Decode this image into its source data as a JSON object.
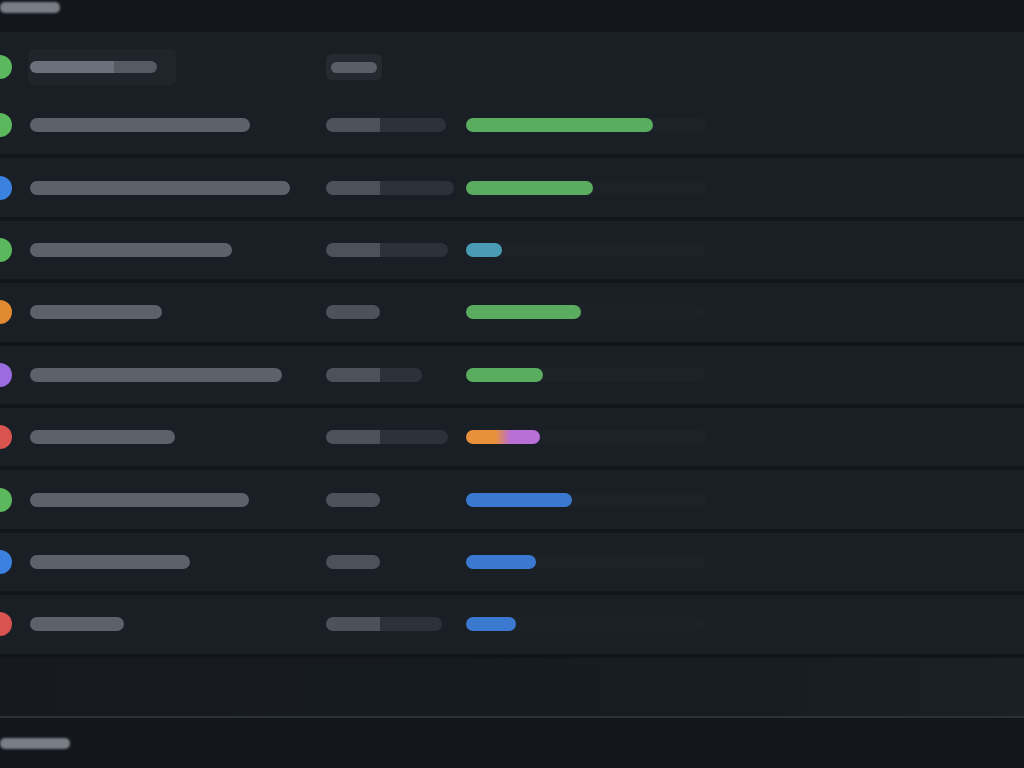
{
  "header": {
    "status": {
      "color": "#5cb85c"
    }
  },
  "rows": [
    {
      "status": {
        "color": "#5cb85c"
      },
      "progress": {
        "color": "#5aad5e",
        "level": 0.78
      }
    },
    {
      "status": {
        "color": "#3b82e0"
      },
      "progress": {
        "color": "#5aad5e",
        "level": 0.53
      }
    },
    {
      "status": {
        "color": "#5cb85c"
      },
      "progress": {
        "color": "#4a9cb5",
        "level": 0.15
      }
    },
    {
      "status": {
        "color": "#e08a30"
      },
      "progress": {
        "color": "#5aad5e",
        "level": 0.48
      }
    },
    {
      "status": {
        "color": "#9b6be0"
      },
      "progress": {
        "color": "#5aad5e",
        "level": 0.32
      }
    },
    {
      "status": {
        "color": "#d9534f"
      },
      "progress": {
        "stops": [
          {
            "color": "#e8913a"
          },
          {
            "color": "#b86fd6"
          }
        ],
        "level": 0.31
      }
    },
    {
      "status": {
        "color": "#5cb85c"
      },
      "progress": {
        "color": "#3b78d0",
        "level": 0.44
      }
    },
    {
      "status": {
        "color": "#3b82e0"
      },
      "progress": {
        "color": "#3b78d0",
        "level": 0.29
      }
    },
    {
      "status": {
        "color": "#d9534f"
      },
      "progress": {
        "color": "#3b78d0",
        "level": 0.21
      }
    }
  ]
}
